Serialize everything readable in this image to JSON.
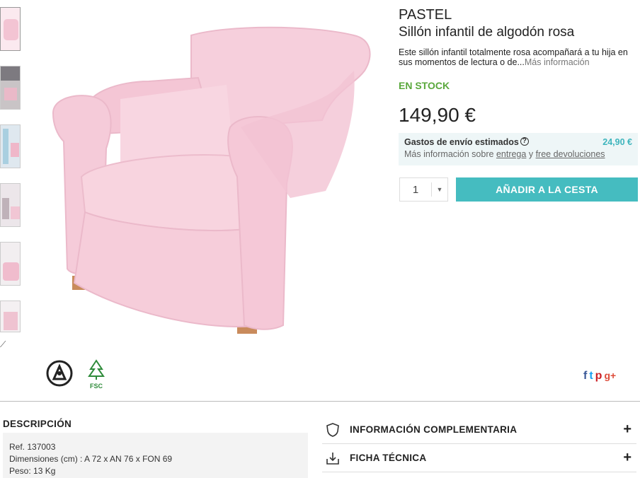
{
  "product": {
    "brand": "PASTEL",
    "title": "Sillón infantil de algodón rosa",
    "description": "Este sillón infantil totalmente rosa acompañará a tu hija en sus momentos de lectura o de...",
    "more_link": "Más información",
    "stock": "EN STOCK",
    "price": "149,90 €"
  },
  "shipping": {
    "label": "Gastos de envío estimados",
    "price": "24,90 €",
    "sub_prefix": "Más información sobre",
    "delivery_link": "entrega",
    "and": "y",
    "returns_link": "free devoluciones"
  },
  "cart": {
    "quantity": "1",
    "add_label": "AÑADIR A LA CESTA"
  },
  "eco_badges": {
    "fsc": "FSC"
  },
  "social": [
    "f",
    "t",
    "p",
    "g+"
  ],
  "description_section": {
    "title": "DESCRIPCIÓN",
    "ref": "Ref. 137003",
    "dimensions": "Dimensiones (cm) : A 72 x AN 76 x FON 69",
    "weight": "Peso: 13 Kg"
  },
  "accordion": {
    "info": "INFORMACIÓN COMPLEMENTARIA",
    "tech": "FICHA TÉCNICA"
  },
  "colors": {
    "accent": "#45bcc0",
    "stock": "#5aa83c",
    "chair_pink": "#f7cfdc",
    "facebook": "#3b5998",
    "twitter": "#1da1f2",
    "pinterest": "#cb2027",
    "google": "#dd4b39"
  }
}
